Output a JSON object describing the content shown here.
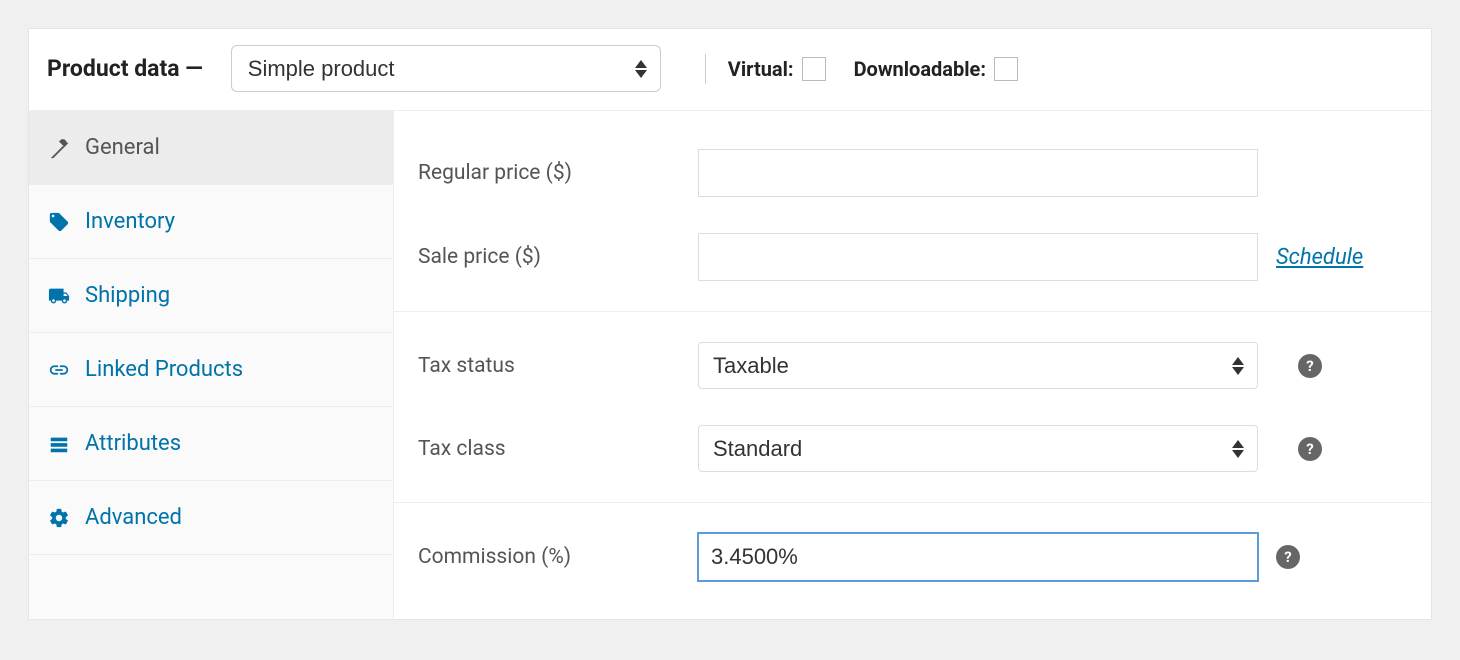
{
  "header": {
    "title": "Product data —",
    "product_type_selected": "Simple product",
    "virtual_label": "Virtual:",
    "downloadable_label": "Downloadable:"
  },
  "tabs": [
    {
      "key": "general",
      "label": "General",
      "icon": "wrench-icon",
      "active": true
    },
    {
      "key": "inventory",
      "label": "Inventory",
      "icon": "tag-icon",
      "active": false
    },
    {
      "key": "shipping",
      "label": "Shipping",
      "icon": "truck-icon",
      "active": false
    },
    {
      "key": "linked",
      "label": "Linked Products",
      "icon": "link-icon",
      "active": false
    },
    {
      "key": "attributes",
      "label": "Attributes",
      "icon": "list-icon",
      "active": false
    },
    {
      "key": "advanced",
      "label": "Advanced",
      "icon": "gear-icon",
      "active": false
    }
  ],
  "fields": {
    "regular_price": {
      "label": "Regular price ($)",
      "value": ""
    },
    "sale_price": {
      "label": "Sale price ($)",
      "value": "",
      "schedule_label": "Schedule"
    },
    "tax_status": {
      "label": "Tax status",
      "selected": "Taxable"
    },
    "tax_class": {
      "label": "Tax class",
      "selected": "Standard"
    },
    "commission": {
      "label": "Commission (%)",
      "value": "3.4500%"
    }
  },
  "helptip_glyph": "?"
}
